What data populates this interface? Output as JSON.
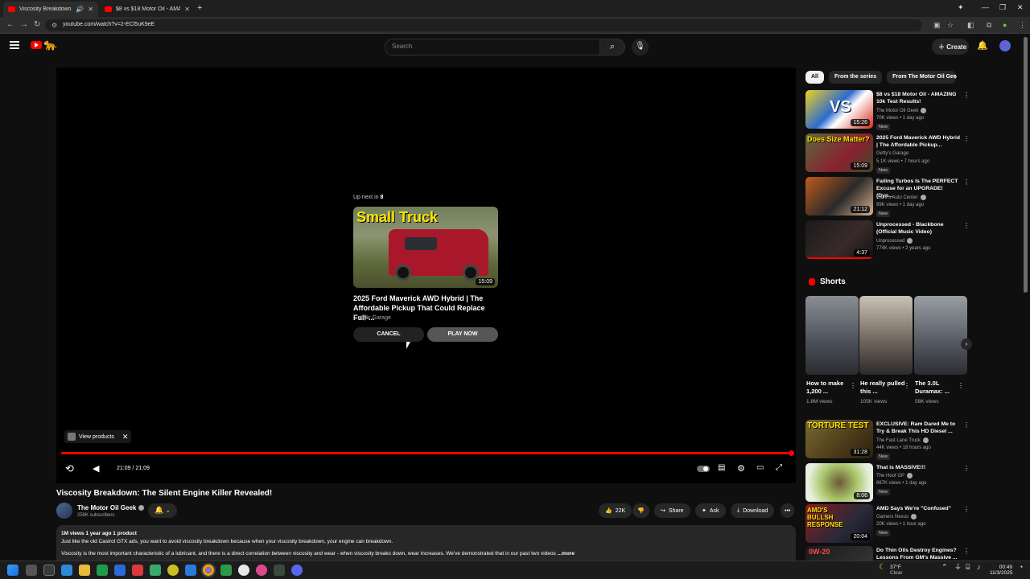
{
  "browser": {
    "tabs": [
      {
        "title": "Viscosity Breakdown: The S",
        "active": true
      },
      {
        "title": "$8 vs $18 Motor Oil - AMAZIN",
        "active": false
      }
    ],
    "url": "youtube.com/watch?v=2-ECl5uK9eE"
  },
  "header": {
    "search_placeholder": "Search",
    "create_label": "Create"
  },
  "player": {
    "upnext_label": "Up next in",
    "upnext_seconds": "8",
    "thumb_text": "Small Truck",
    "next_duration": "15:09",
    "next_title": "2025 Ford Maverick AWD Hybrid | The Affordable Pickup That Could Replace Full-...",
    "next_channel": "Getty's Garage",
    "cancel_label": "CANCEL",
    "play_now_label": "PLAY NOW",
    "view_products_label": "View products",
    "time_display": "21:09 / 21:09",
    "progress_fraction": 1.0,
    "accent_color": "#ff0000"
  },
  "video": {
    "title": "Viscosity Breakdown: The Silent Engine Killer Revealed!",
    "channel_name": "The Motor Oil Geek",
    "subscribers": "259K subscribers",
    "likes": "22K",
    "share_label": "Share",
    "ask_label": "Ask",
    "download_label": "Download",
    "desc_meta": "1M views  1 year ago  1 product",
    "desc_line1": "Just like the old Castrol GTX ads, you want to avoid viscosity breakdown because when your viscosity breakdown, your engine can breakdown.",
    "desc_line2": "Viscosity is the most important characteristic of a lubricant, and there is a direct correlation between viscosity and wear -  when viscosity breaks down, wear increases. We've demonstrated that in our past two videos",
    "desc_more": "...more"
  },
  "sidebar": {
    "chips": [
      "All",
      "From the series",
      "From The Motor Oil Geek"
    ],
    "recs": [
      {
        "title": "$8 vs $18 Motor Oil - AMAZING 10k Test Results!",
        "channel": "The Motor Oil Geek",
        "meta": "70K views • 1 day ago",
        "badge": "New",
        "duration": "15:26"
      },
      {
        "title": "2025 Ford Maverick AWD Hybrid | The Affordable Pickup...",
        "channel": "Getty's Garage",
        "meta": "5.1K views • 7 hours ago",
        "badge": "New",
        "duration": "15:09"
      },
      {
        "title": "Failing Turbos Is The PERFECT Excuse for an UPGRADE! (Dyn...",
        "channel": "Dave's Auto Center",
        "meta": "99K views • 1 day ago",
        "badge": "New",
        "duration": "21:12"
      },
      {
        "title": "Unprocessed - Blackbone (Official Music Video)",
        "channel": "Unprocessed",
        "meta": "774K views • 2 years ago",
        "badge": "",
        "duration": "4:37"
      }
    ],
    "shorts_heading": "Shorts",
    "shorts": [
      {
        "title": "How to make 1,200 ...",
        "views": "1.8M views"
      },
      {
        "title": "He really pulled this ...",
        "views": "105K views"
      },
      {
        "title": "The 3.0L Duramax: ...",
        "views": "58K views"
      }
    ],
    "recs2": [
      {
        "title": "EXCLUSIVE: Ram Dared Me to Try & Break This HD Diesel ...",
        "channel": "The Fast Lane Truck",
        "meta": "44K views • 18 hours ago",
        "badge": "New",
        "duration": "31:28",
        "thumb_text": "TORTURE TEST"
      },
      {
        "title": "That is MASSIVE!!!",
        "channel": "The Hoof GP",
        "meta": "867K views • 1 day ago",
        "badge": "New",
        "duration": "8:06",
        "thumb_text": ""
      },
      {
        "title": "AMD Says We're \"Confused\"",
        "channel": "Gamers Nexus",
        "meta": "20K views • 1 hour ago",
        "badge": "New",
        "duration": "20:04",
        "thumb_text": "AMD'S BULLSH RESPONSE"
      },
      {
        "title": "Do Thin Oils Destroy Engines? Lessons From GM's Massive ...",
        "channel": "",
        "meta": "",
        "badge": "",
        "duration": "",
        "thumb_text": "0W-20"
      }
    ]
  },
  "taskbar": {
    "weather_temp": "37°F",
    "weather_desc": "Clear",
    "clock_time": "00:49",
    "clock_date": "11/3/2025"
  }
}
